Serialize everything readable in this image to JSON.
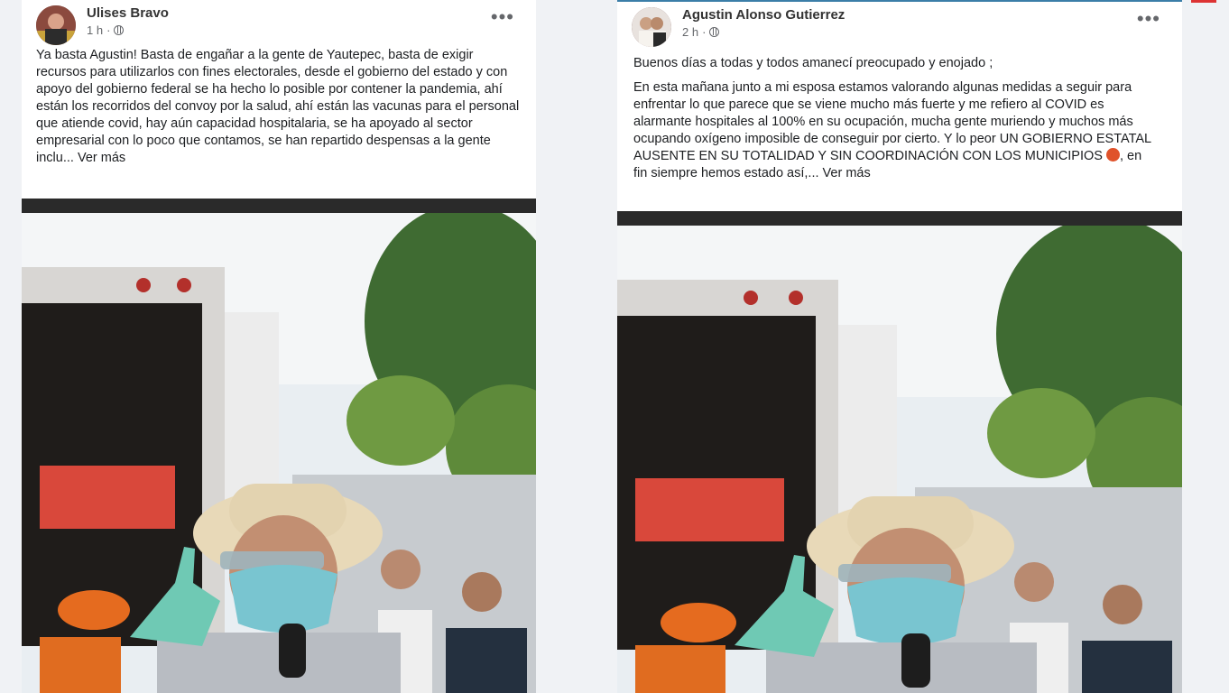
{
  "posts": [
    {
      "author": "Ulises Bravo",
      "time": "1 h",
      "more": "•••",
      "paragraphs": [
        "Ya basta Agustin! Basta de engañar a la gente de Yautepec, basta de exigir recursos para utilizarlos con fines electorales, desde el gobierno del estado y con apoyo del gobierno federal se ha hecho lo posible por contener la pandemia, ahí están los recorridos del convoy por la salud, ahí están las vacunas para el personal que atiende covid, hay aún capacidad hospitalaria, se ha apoyado al sector empresarial con lo poco que contamos, se han repartido despensas a la gente inclu..."
      ],
      "see_more": "Ver más"
    },
    {
      "author": "Agustin Alonso Gutierrez",
      "time": "2 h",
      "more": "•••",
      "paragraphs": [
        "Buenos días a todas y todos amanecí preocupado y enojado ;",
        "En esta mañana junto a mi esposa estamos valorando algunas medidas a seguir para enfrentar lo que parece que se viene mucho más fuerte y me refiero al COVID es alarmante hospitales al 100% en su ocupación, mucha gente muriendo y muchos más ocupando oxígeno imposible de conseguir por cierto. Y lo peor UN GOBIERNO ESTATAL AUSENTE EN SU TOTALIDAD Y SIN COORDINACIÓN CON LOS MUNICIPIOS"
      ],
      "after_emoji": ", en fin siempre hemos estado así,...",
      "emoji_icon": "angry-face-icon",
      "see_more": "Ver más"
    }
  ],
  "colors": {
    "background": "#f0f2f5",
    "card": "#ffffff",
    "meta_text": "#65676b",
    "accent_bar": "#3b7ea8"
  }
}
